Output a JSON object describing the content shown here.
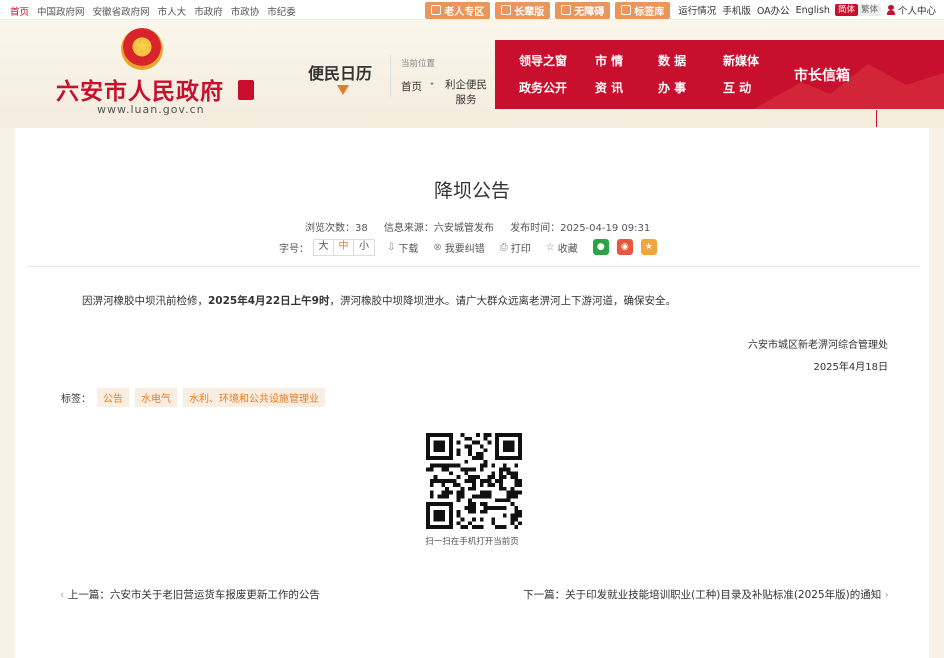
{
  "topbar": {
    "links": [
      "首页",
      "中国政府网",
      "安徽省政府网",
      "市人大",
      "市政府",
      "市政协",
      "市纪委"
    ],
    "buttons": [
      "老人专区",
      "长辈版",
      "无障碍",
      "标签库"
    ],
    "right_links": [
      "运行情况",
      "手机版",
      "OA办公",
      "English"
    ],
    "lang_simplified": "简体",
    "lang_traditional": "繁体",
    "user_center": "个人中心"
  },
  "header": {
    "site_title": "六安市人民政府",
    "site_domain": "www.luan.gov.cn",
    "calendar": "便民日历",
    "location_label": "当前位置",
    "location_home": "首页",
    "location_category": "利企便民服务",
    "nav": {
      "row1": [
        "领导之窗",
        "市 情",
        "数 据",
        "新媒体"
      ],
      "row2": [
        "政务公开",
        "资 讯",
        "办 事",
        "互 动"
      ],
      "mayor": "市长信箱"
    }
  },
  "article": {
    "title": "降坝公告",
    "views": "浏览次数：38",
    "source": "信息来源：六安城管发布",
    "published": "发布时间：2025-04-19 09:31",
    "font_label": "字号：",
    "font_sizes": [
      "大",
      "中",
      "小"
    ],
    "tools": [
      "下载",
      "我要纠错",
      "打印",
      "收藏"
    ],
    "body_pre": "因淠河橡胶中坝汛前检修，",
    "body_bold": "2025年4月22日上午9时",
    "body_post": "，淠河橡胶中坝降坝泄水。请广大群众远离老淠河上下游河道，确保安全。",
    "signature_org": "六安市城区新老淠河综合管理处",
    "signature_date": "2025年4月18日",
    "tags_label": "标签：",
    "tags": [
      "公告",
      "水电气",
      "水利、环境和公共设施管理业"
    ],
    "qr_caption": "扫一扫在手机打开当前页",
    "prev": "上一篇：六安市关于老旧营运货车报废更新工作的公告",
    "next": "下一篇：关于印发就业技能培训职业(工种)目录及补贴标准(2025年版)的通知"
  },
  "colors": {
    "brand_red": "#c8102e",
    "accent_orange": "#e67e22"
  }
}
